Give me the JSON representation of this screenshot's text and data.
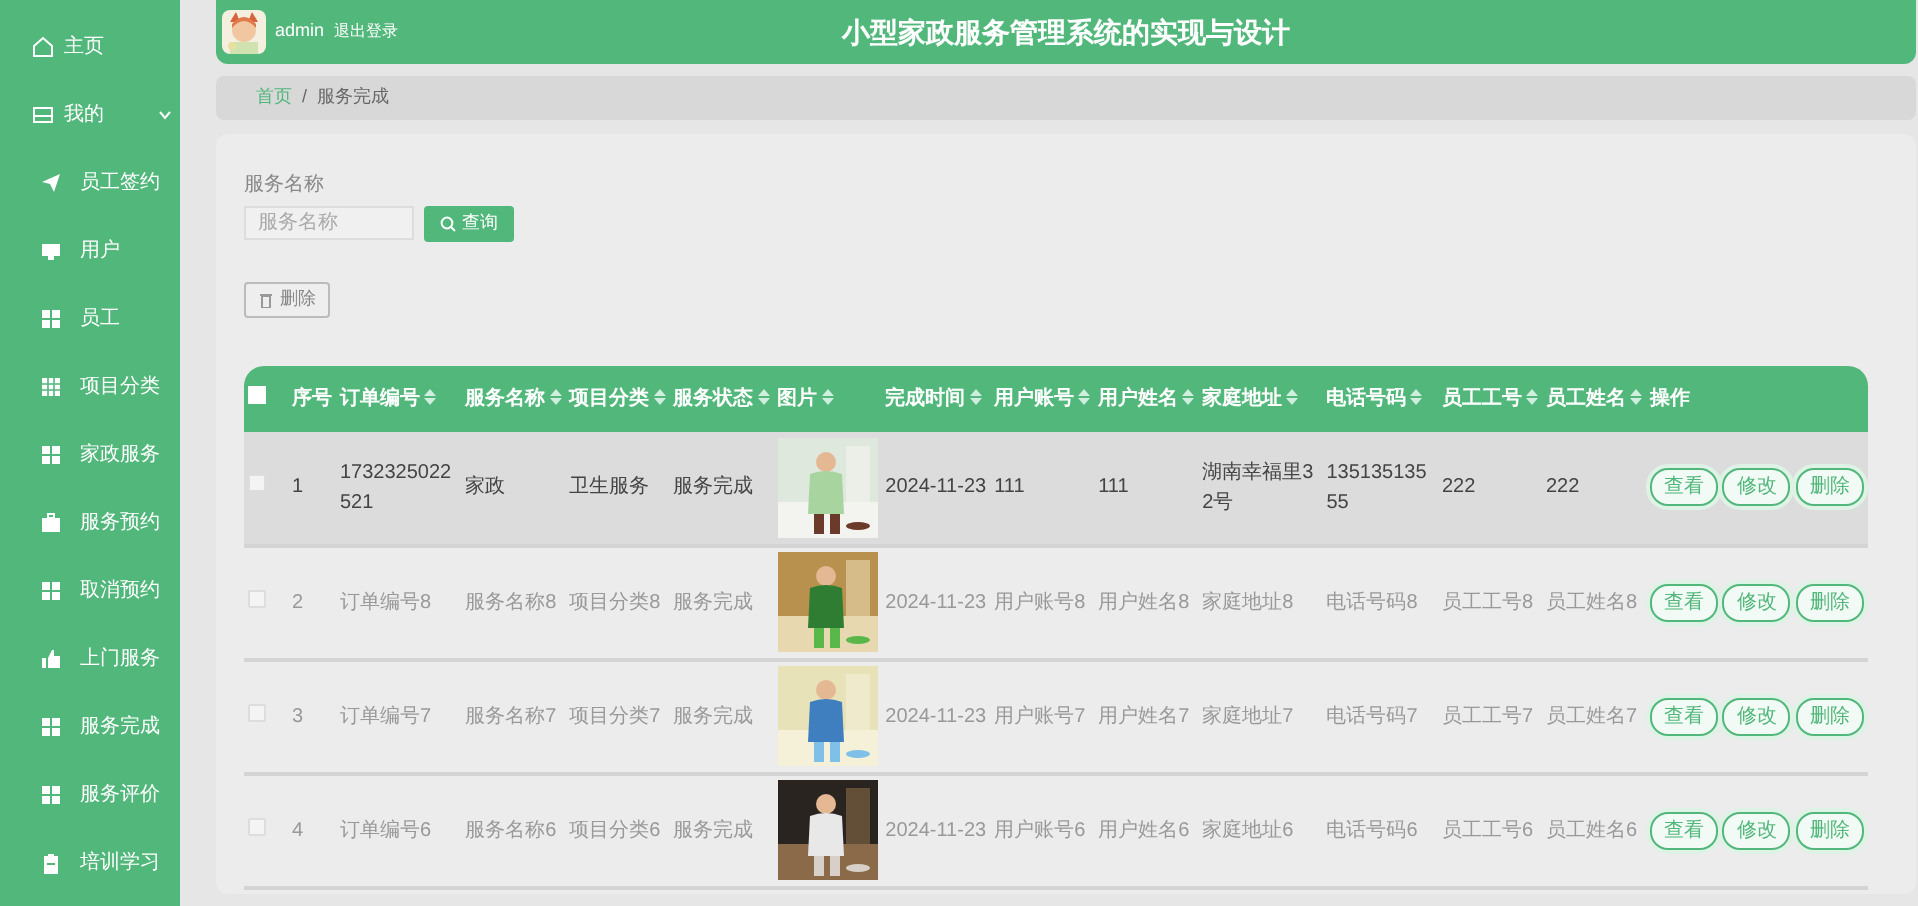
{
  "sidebar": {
    "items": [
      {
        "label": "主页"
      },
      {
        "label": "我的",
        "expanded": true,
        "children": [
          {
            "label": "员工签约"
          },
          {
            "label": "用户"
          },
          {
            "label": "员工"
          },
          {
            "label": "项目分类"
          },
          {
            "label": "家政服务"
          },
          {
            "label": "服务预约"
          },
          {
            "label": "取消预约"
          },
          {
            "label": "上门服务"
          },
          {
            "label": "服务完成"
          },
          {
            "label": "服务评价"
          },
          {
            "label": "培训学习"
          }
        ]
      }
    ]
  },
  "header": {
    "user": "admin",
    "logout": "退出登录",
    "title": "小型家政服务管理系统的实现与设计"
  },
  "breadcrumb": [
    {
      "label": "首页",
      "link": true
    },
    {
      "separator": "/",
      "label": "服务完成",
      "link": false
    }
  ],
  "search": {
    "label": "服务名称",
    "placeholder": "服务名称",
    "button": "查询"
  },
  "delete_button": "删除",
  "table": {
    "select_all": {
      "checked": false
    },
    "columns": [
      {
        "label": "序号",
        "sortable": false
      },
      {
        "label": "订单编号",
        "sortable": true
      },
      {
        "label": "服务名称",
        "sortable": true
      },
      {
        "label": "项目分类",
        "sortable": true
      },
      {
        "label": "服务状态",
        "sortable": true
      },
      {
        "label": "图片",
        "sortable": true
      },
      {
        "label": "完成时间",
        "sortable": true
      },
      {
        "label": "用户账号",
        "sortable": true
      },
      {
        "label": "用户姓名",
        "sortable": true
      },
      {
        "label": "家庭地址",
        "sortable": true
      },
      {
        "label": "电话号码",
        "sortable": true
      },
      {
        "label": "员工工号",
        "sortable": true
      },
      {
        "label": "员工姓名",
        "sortable": true
      },
      {
        "label": "操作",
        "sortable": false
      }
    ],
    "rows": [
      {
        "checked": false,
        "highlighted": true,
        "cells": [
          "1",
          "1732325022521",
          "家政",
          "卫生服务",
          "服务完成",
          {
            "kind": "picture"
          },
          "2024-11-23",
          "111",
          "111",
          "湖南幸福里32号",
          "13513513555",
          "222",
          "222"
        ],
        "actions": [
          "查看",
          "修改",
          "删除"
        ]
      },
      {
        "checked": false,
        "highlighted": false,
        "cells": [
          "2",
          "订单编号8",
          "服务名称8",
          "项目分类8",
          "服务完成",
          {
            "kind": "picture"
          },
          "2024-11-23",
          "用户账号8",
          "用户姓名8",
          "家庭地址8",
          "电话号码8",
          "员工工号8",
          "员工姓名8"
        ],
        "actions": [
          "查看",
          "修改",
          "删除"
        ]
      },
      {
        "checked": false,
        "highlighted": false,
        "cells": [
          "3",
          "订单编号7",
          "服务名称7",
          "项目分类7",
          "服务完成",
          {
            "kind": "picture"
          },
          "2024-11-23",
          "用户账号7",
          "用户姓名7",
          "家庭地址7",
          "电话号码7",
          "员工工号7",
          "员工姓名7"
        ],
        "actions": [
          "查看",
          "修改",
          "删除"
        ]
      },
      {
        "checked": false,
        "highlighted": false,
        "cells": [
          "4",
          "订单编号6",
          "服务名称6",
          "项目分类6",
          "服务完成",
          {
            "kind": "picture"
          },
          "2024-11-23",
          "用户账号6",
          "用户姓名6",
          "家庭地址6",
          "电话号码6",
          "员工工号6",
          "员工姓名6"
        ],
        "actions": [
          "查看",
          "修改",
          "删除"
        ]
      }
    ]
  }
}
